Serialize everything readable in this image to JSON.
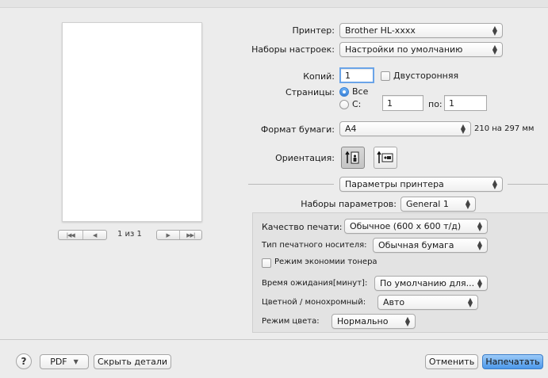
{
  "preview": {
    "page_indicator": "1 из 1",
    "nav_first": "|◀◀",
    "nav_prev": "◀",
    "nav_next": "▶",
    "nav_last": "▶▶|"
  },
  "printer": {
    "label": "Принтер:",
    "value": "Brother HL-xxxx"
  },
  "presets": {
    "label": "Наборы настроек:",
    "value": "Настройки по умолчанию"
  },
  "copies": {
    "label": "Копий:",
    "value": "1",
    "duplex_label": "Двусторонняя",
    "duplex_checked": false
  },
  "pages": {
    "label": "Страницы:",
    "all_label": "Все",
    "from_label": "С:",
    "from_value": "1",
    "to_label": "по:",
    "to_value": "1",
    "selected": "all"
  },
  "paper": {
    "label": "Формат бумаги:",
    "value": "A4",
    "size_text": "210 на 297 мм"
  },
  "orientation": {
    "label": "Ориентация:",
    "selected": "portrait"
  },
  "section_popup": {
    "value": "Параметры принтера"
  },
  "feature_sets": {
    "label": "Наборы параметров:",
    "value": "General 1"
  },
  "printer_options": {
    "quality": {
      "label": "Качество печати:",
      "value": "Обычное (600 x 600 т/д)"
    },
    "media": {
      "label": "Тип печатного носителя:",
      "value": "Обычная бумага"
    },
    "toner_save": {
      "label": "Режим экономии тонера",
      "checked": false
    },
    "sleep": {
      "label": "Время ожидания[минут]:",
      "value": "По умолчанию для..."
    },
    "color_mono": {
      "label": "Цветной / монохромный:",
      "value": "Авто"
    },
    "color_mode": {
      "label": "Режим цвета:",
      "value": "Нормально"
    }
  },
  "footer": {
    "help": "?",
    "pdf": "PDF",
    "hide_details": "Скрыть детали",
    "cancel": "Отменить",
    "print": "Напечатать"
  },
  "colors": {
    "window_bg": "#ececec",
    "accent_blue": "#4c97ea",
    "focus_ring": "#6aa4e8"
  }
}
